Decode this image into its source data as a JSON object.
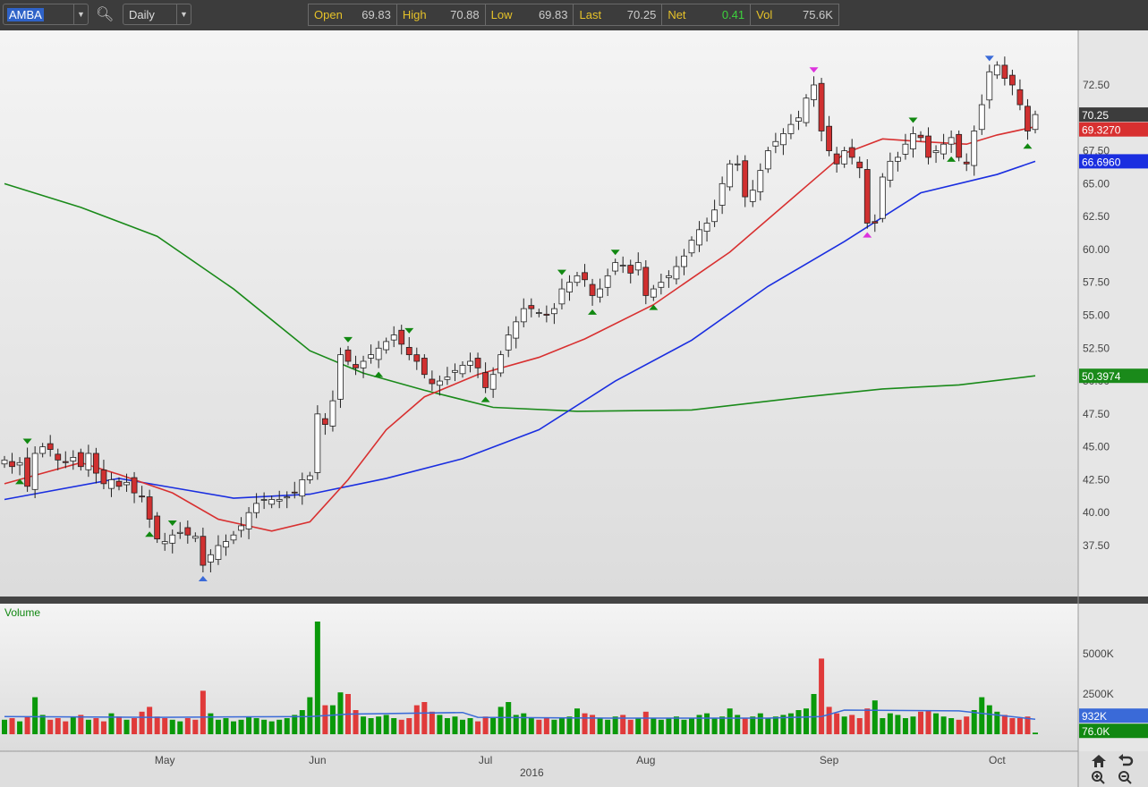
{
  "toolbar": {
    "symbol": "AMBA",
    "period": "Daily"
  },
  "quote": [
    {
      "label": "Open",
      "value": "69.83"
    },
    {
      "label": "High",
      "value": "70.88"
    },
    {
      "label": "Low",
      "value": "69.83"
    },
    {
      "label": "Last",
      "value": "70.25"
    },
    {
      "label": "Net",
      "value": "0.41"
    },
    {
      "label": "Vol",
      "value": "75.6K"
    }
  ],
  "colors": {
    "up": "#ffffff",
    "down": "#d03030",
    "ma20": "#d83030",
    "ma50": "#1a2ee0",
    "ma200": "#1a8a1a",
    "net": "#3cd23c",
    "volUp": "#0a990a",
    "volDown": "#e03a3a",
    "volAvg": "#3a6ad8"
  },
  "chart_data": {
    "type": "candlestick",
    "title": "AMBA Daily",
    "price_axis": {
      "ticks": [
        "37.50",
        "40.00",
        "42.50",
        "45.00",
        "47.50",
        "50.00",
        "52.50",
        "55.00",
        "57.50",
        "60.00",
        "62.50",
        "65.00",
        "67.50",
        "72.50"
      ],
      "range": [
        33.5,
        75.5
      ]
    },
    "x_labels": [
      {
        "label": "May",
        "bar": 21
      },
      {
        "label": "Jun",
        "bar": 41
      },
      {
        "label": "Jul",
        "bar": 63
      },
      {
        "label": "Aug",
        "bar": 84
      },
      {
        "label": "Sep",
        "bar": 108
      },
      {
        "label": "Oct",
        "bar": 130
      }
    ],
    "year_label": {
      "label": "2016",
      "bar": 70
    },
    "closes": [
      44,
      43.5,
      43.8,
      42,
      44.5,
      45,
      44.8,
      44,
      43.8,
      44.2,
      43.5,
      44.5,
      43,
      42.2,
      42.5,
      42,
      42.3,
      41.5,
      41.2,
      39.5,
      38,
      37.8,
      38.3,
      38.5,
      38.3,
      38.2,
      36,
      36.8,
      37.5,
      37.8,
      38.3,
      39,
      40,
      40.7,
      41,
      41,
      41,
      41.2,
      41.5,
      42.5,
      42.8,
      47.5,
      46.7,
      48.5,
      52,
      51.5,
      51,
      51.5,
      52,
      52.5,
      53,
      53.5,
      52.8,
      52,
      51.5,
      50.5,
      49.8,
      50,
      50.3,
      50.8,
      51.2,
      51.5,
      51,
      49.5,
      50.5,
      52,
      53.5,
      54.5,
      55.5,
      55.5,
      55.2,
      55,
      55.5,
      57,
      57.5,
      58,
      57.7,
      56.5,
      57,
      58,
      59,
      58.8,
      58.2,
      59,
      56.5,
      57,
      57.5,
      58,
      58.7,
      59.5,
      60.7,
      61.5,
      62,
      63,
      65,
      66.5,
      66.5,
      64,
      64.5,
      66,
      67.5,
      68.2,
      68.8,
      69.5,
      70,
      71.5,
      72.5,
      69,
      67.5,
      66.5,
      67.5,
      67,
      66.2,
      62,
      62,
      65.5,
      66.7,
      67,
      68,
      68.8,
      68.5,
      67,
      67.5,
      68,
      68.5,
      67,
      66.5,
      69,
      71,
      73.5,
      74,
      73,
      72.5,
      71,
      69,
      70.25
    ],
    "volumes": [
      900,
      1000,
      800,
      1100,
      2300,
      1200,
      900,
      1000,
      800,
      1100,
      1200,
      900,
      1000,
      800,
      1300,
      1100,
      900,
      1000,
      1400,
      1700,
      1100,
      1000,
      900,
      800,
      1000,
      900,
      2700,
      1300,
      900,
      1000,
      800,
      900,
      1100,
      1000,
      900,
      800,
      900,
      1000,
      1200,
      1500,
      2300,
      7000,
      1800,
      1800,
      2600,
      2500,
      1500,
      1100,
      1000,
      1100,
      1200,
      1000,
      900,
      1000,
      1800,
      2000,
      1400,
      1200,
      1000,
      1100,
      900,
      1000,
      800,
      1100,
      1000,
      1700,
      2000,
      1200,
      1300,
      1000,
      900,
      1000,
      900,
      1000,
      1100,
      1600,
      1300,
      1200,
      1000,
      900,
      1100,
      1200,
      900,
      1000,
      1400,
      1000,
      900,
      1000,
      1100,
      900,
      1000,
      1200,
      1300,
      1000,
      1100,
      1600,
      1200,
      1000,
      1100,
      1300,
      1000,
      1100,
      1200,
      1300,
      1500,
      1600,
      2500,
      4700,
      1700,
      1300,
      1100,
      1200,
      1000,
      1600,
      2100,
      1000,
      1300,
      1200,
      1000,
      1100,
      1400,
      1500,
      1300,
      1100,
      1000,
      900,
      1100,
      1500,
      2300,
      1800,
      1400,
      1200,
      1000,
      1000,
      1100,
      100
    ],
    "vol_axis": {
      "ticks": [
        "2500K",
        "5000K"
      ]
    },
    "ma20": [
      [
        0,
        42.2
      ],
      [
        10,
        43.8
      ],
      [
        15,
        42.9
      ],
      [
        22,
        41.5
      ],
      [
        28,
        39.5
      ],
      [
        35,
        38.6
      ],
      [
        40,
        39.3
      ],
      [
        45,
        42.5
      ],
      [
        50,
        46.3
      ],
      [
        55,
        48.8
      ],
      [
        62,
        50.5
      ],
      [
        70,
        51.8
      ],
      [
        76,
        53.2
      ],
      [
        85,
        55.8
      ],
      [
        95,
        59.8
      ],
      [
        105,
        64.8
      ],
      [
        110,
        67.3
      ],
      [
        115,
        68.4
      ],
      [
        120,
        68.2
      ],
      [
        126,
        68.0
      ],
      [
        130,
        68.7
      ],
      [
        135,
        69.327
      ]
    ],
    "ma50": [
      [
        0,
        41.0
      ],
      [
        15,
        42.6
      ],
      [
        22,
        41.9
      ],
      [
        30,
        41.1
      ],
      [
        40,
        41.4
      ],
      [
        50,
        42.6
      ],
      [
        60,
        44.1
      ],
      [
        70,
        46.3
      ],
      [
        80,
        50.0
      ],
      [
        90,
        53.1
      ],
      [
        100,
        57.2
      ],
      [
        110,
        60.6
      ],
      [
        120,
        64.3
      ],
      [
        130,
        65.7
      ],
      [
        135,
        66.696
      ]
    ],
    "ma200": [
      [
        0,
        65.0
      ],
      [
        10,
        63.2
      ],
      [
        20,
        61.0
      ],
      [
        30,
        57.0
      ],
      [
        40,
        52.3
      ],
      [
        47,
        50.6
      ],
      [
        55,
        49.3
      ],
      [
        64,
        48.0
      ],
      [
        75,
        47.7
      ],
      [
        90,
        47.8
      ],
      [
        105,
        48.8
      ],
      [
        115,
        49.4
      ],
      [
        125,
        49.7
      ],
      [
        135,
        50.3974
      ]
    ],
    "vol_avg": [
      [
        0,
        1100
      ],
      [
        20,
        1050
      ],
      [
        40,
        1100
      ],
      [
        45,
        1250
      ],
      [
        60,
        1350
      ],
      [
        62,
        1050
      ],
      [
        80,
        1000
      ],
      [
        100,
        1000
      ],
      [
        107,
        1100
      ],
      [
        110,
        1500
      ],
      [
        125,
        1450
      ],
      [
        135,
        932
      ]
    ],
    "last_labels": {
      "last": "70.25",
      "ma20": "69.3270",
      "ma50": "66.6960",
      "ma200": "50.3974",
      "vol_avg": "932K",
      "vol": "76.0K"
    },
    "volume_label": "Volume",
    "markers": [
      {
        "bar": 2,
        "type": "low",
        "color": "#118811"
      },
      {
        "bar": 3,
        "type": "high",
        "color": "#118811"
      },
      {
        "bar": 19,
        "type": "low",
        "color": "#118811"
      },
      {
        "bar": 22,
        "type": "high",
        "color": "#118811"
      },
      {
        "bar": 26,
        "type": "low",
        "color": "#3a6ad8"
      },
      {
        "bar": 45,
        "type": "high",
        "color": "#118811"
      },
      {
        "bar": 49,
        "type": "low",
        "color": "#118811"
      },
      {
        "bar": 53,
        "type": "high",
        "color": "#118811"
      },
      {
        "bar": 63,
        "type": "low",
        "color": "#118811"
      },
      {
        "bar": 73,
        "type": "high",
        "color": "#118811"
      },
      {
        "bar": 77,
        "type": "low",
        "color": "#118811"
      },
      {
        "bar": 80,
        "type": "high",
        "color": "#118811"
      },
      {
        "bar": 85,
        "type": "low",
        "color": "#118811"
      },
      {
        "bar": 106,
        "type": "high",
        "color": "#dd33dd"
      },
      {
        "bar": 113,
        "type": "low",
        "color": "#dd33dd"
      },
      {
        "bar": 119,
        "type": "high",
        "color": "#118811"
      },
      {
        "bar": 124,
        "type": "low",
        "color": "#118811"
      },
      {
        "bar": 129,
        "type": "high",
        "color": "#3a6ad8"
      },
      {
        "bar": 134,
        "type": "low",
        "color": "#118811"
      }
    ]
  }
}
